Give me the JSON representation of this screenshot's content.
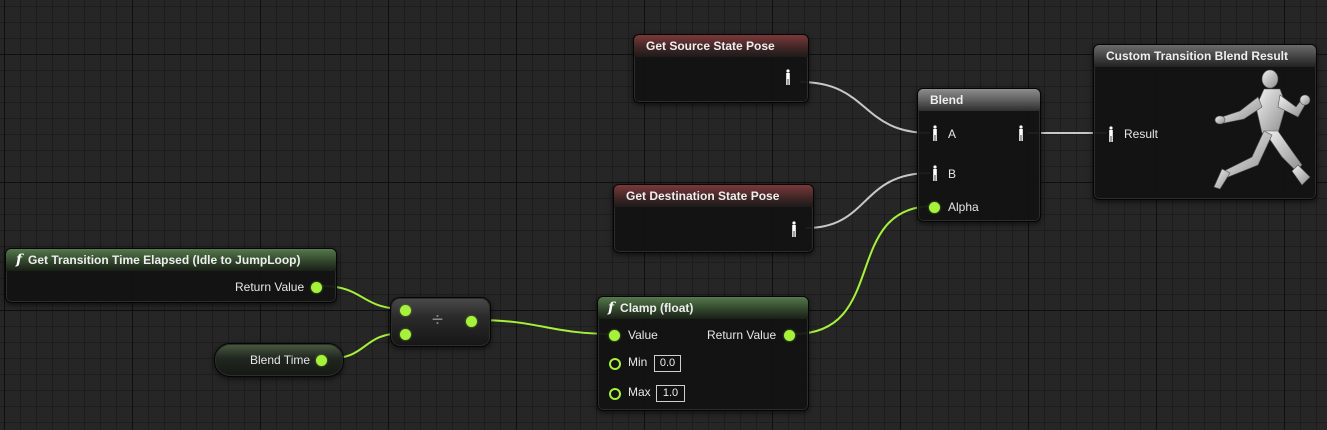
{
  "nodes": {
    "get_source": {
      "title": "Get Source State Pose"
    },
    "get_destination": {
      "title": "Get Destination State Pose"
    },
    "blend": {
      "title": "Blend",
      "pin_a": "A",
      "pin_b": "B",
      "pin_alpha": "Alpha"
    },
    "result": {
      "title": "Custom Transition Blend Result",
      "pin_result": "Result"
    },
    "get_time": {
      "title": "Get Transition Time Elapsed (Idle to JumpLoop)",
      "return_label": "Return Value"
    },
    "blend_time": {
      "label": "Blend Time"
    },
    "divide": {
      "symbol": "÷"
    },
    "clamp": {
      "title": "Clamp (float)",
      "value_label": "Value",
      "return_label": "Return Value",
      "min_label": "Min",
      "min_value": "0.0",
      "max_label": "Max",
      "max_value": "1.0"
    }
  },
  "icons": {
    "function": "f",
    "pose_pin": "pose-pin-icon",
    "float_pin": "float-pin-icon",
    "mannequin": "running-mannequin-icon"
  },
  "colors": {
    "float_wire": "#a6f23b",
    "pose_wire": "#c8c8c8",
    "state_header": "#7b3838",
    "function_header": "#55794c"
  }
}
